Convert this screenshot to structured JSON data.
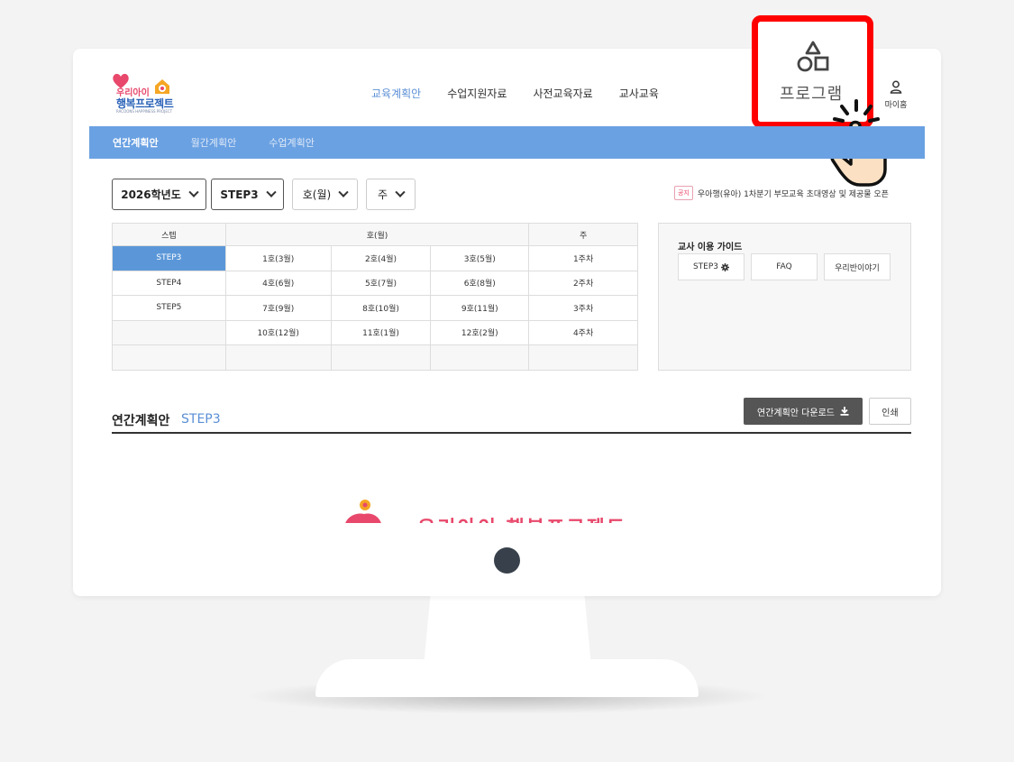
{
  "logo": {
    "badge": "꿈나무",
    "line1": "우리아이",
    "line2": "행복프로젝트",
    "line3": "RACOONS HAPPINESS PROJECT"
  },
  "nav": {
    "items": [
      "교육계획안",
      "수업지원자료",
      "사전교육자료",
      "교사교육"
    ],
    "active_index": 0
  },
  "header": {
    "program_label": "프로그램",
    "program_label_small": "램",
    "mypage_label": "마이홈"
  },
  "subnav": {
    "items": [
      "연간계획안",
      "월간계획안",
      "수업계획안"
    ],
    "active_index": 0
  },
  "filters": {
    "year": "2026학년도",
    "step": "STEP3",
    "issue": "호(월)",
    "week": "주"
  },
  "notice": {
    "tag": "공지",
    "text": "우아행(유아) 1차분기 부모교육 초대영상 및 제공물 오픈"
  },
  "table": {
    "headers": [
      "스텝",
      "호(월)",
      "주"
    ],
    "rows": [
      [
        "STEP3",
        "1호(3월)",
        "2호(4월)",
        "3호(5월)",
        "1주차"
      ],
      [
        "STEP4",
        "4호(6월)",
        "5호(7월)",
        "6호(8월)",
        "2주차"
      ],
      [
        "STEP5",
        "7호(9월)",
        "8호(10월)",
        "9호(11월)",
        "3주차"
      ],
      [
        "",
        "10호(12월)",
        "11호(1월)",
        "12호(2월)",
        "4주차"
      ],
      [
        "",
        "",
        "",
        "",
        ""
      ]
    ],
    "selected_step": "STEP3"
  },
  "guide": {
    "title": "교사 이용 가이드",
    "buttons": [
      "STEP3",
      "FAQ",
      "우리반이야기"
    ]
  },
  "annual": {
    "title": "연간계획안",
    "step": "STEP3",
    "download_label": "연간계획안 다운로드",
    "print_label": "인쇄"
  },
  "preview": {
    "text": "우리아이 행복프로젝트"
  },
  "colors": {
    "accent_blue": "#6aa1e2",
    "selected_blue": "#5b97d8",
    "brand_pink": "#e8486b",
    "highlight_red": "#ff0000"
  }
}
